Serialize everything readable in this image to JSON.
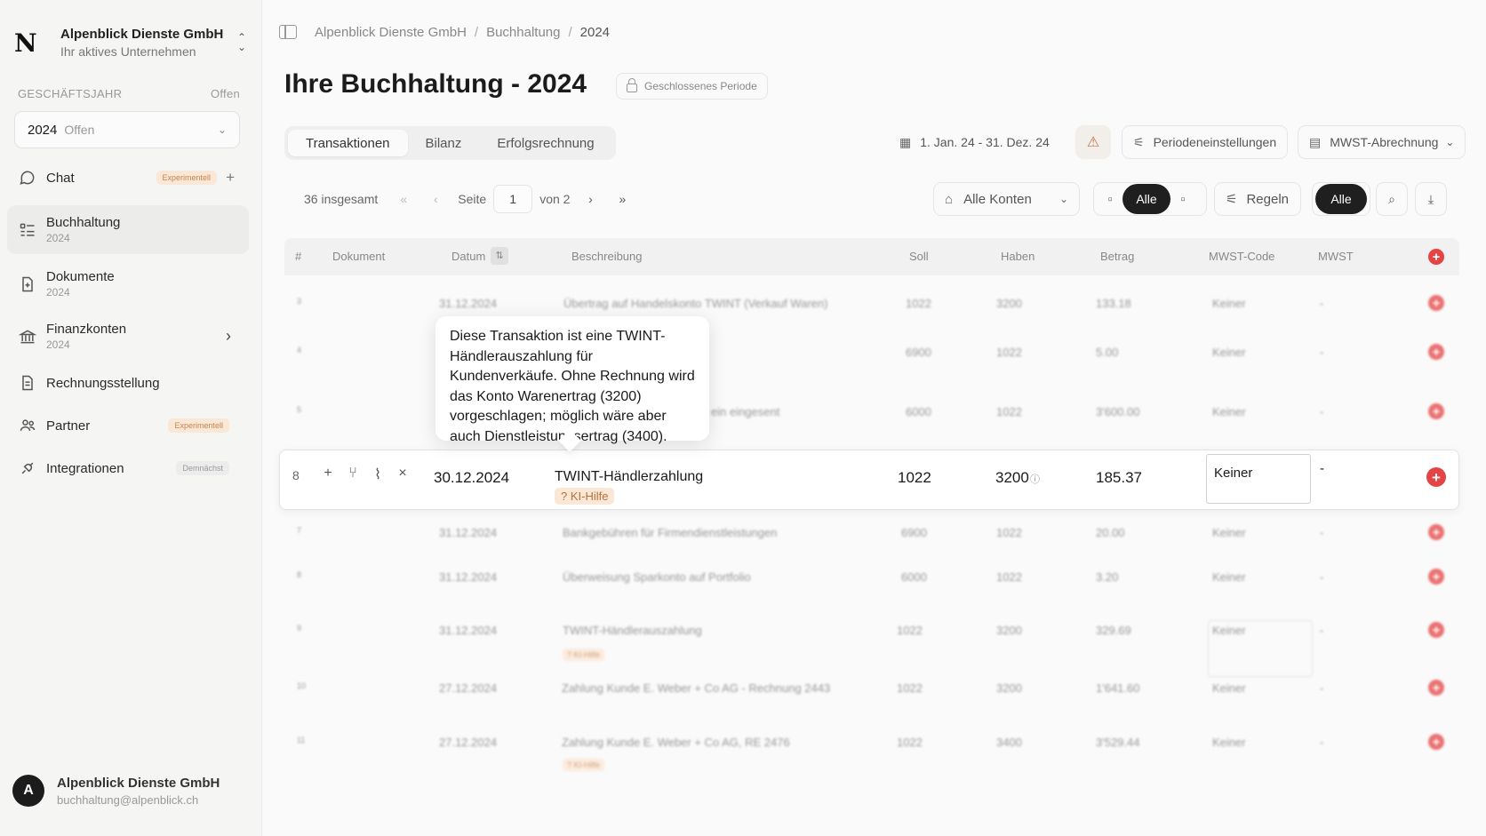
{
  "workspace": {
    "logo": "N",
    "name": "Alpenblick Dienste GmbH",
    "subtitle": "Ihr aktives Unternehmen"
  },
  "fiscal_year": {
    "heading": "GESCHÄFTSJAHR",
    "status": "Offen",
    "selected_year": "2024",
    "selected_status": "Offen"
  },
  "nav": {
    "chat": {
      "label": "Chat",
      "badge": "Experimentell"
    },
    "buchhaltung": {
      "label": "Buchhaltung",
      "sub": "2024"
    },
    "dokumente": {
      "label": "Dokumente",
      "sub": "2024"
    },
    "finanzkonten": {
      "label": "Finanzkonten",
      "sub": "2024"
    },
    "rechnung": {
      "label": "Rechnungsstellung"
    },
    "partner": {
      "label": "Partner",
      "badge": "Experimentell"
    },
    "integrationen": {
      "label": "Integrationen",
      "badge": "Demnächst"
    }
  },
  "user": {
    "initial": "A",
    "name": "Alpenblick Dienste GmbH",
    "email": "buchhaltung@alpenblick.ch"
  },
  "breadcrumb": [
    "Alpenblick Dienste GmbH",
    "Buchhaltung",
    "2024"
  ],
  "page": {
    "title": "Ihre Buchhaltung - 2024",
    "period_badge": "Geschlossenes Periode"
  },
  "tabs": [
    "Transaktionen",
    "Bilanz",
    "Erfolgsrechnung"
  ],
  "toolbar": {
    "date_range": "1. Jan. 24 - 31. Dez. 24",
    "period_settings": "Periodeneinstellungen",
    "vat_report": "MWST-Abrechnung"
  },
  "pagination": {
    "total": "36 insgesamt",
    "page_label": "Seite",
    "current_page": "1",
    "of_label": "von 2"
  },
  "filters": {
    "accounts": "Alle Konten",
    "doc_filter": "Alle",
    "rules": "Regeln",
    "all": "Alle"
  },
  "table": {
    "headers": {
      "num": "#",
      "document": "Dokument",
      "date": "Datum",
      "description": "Beschreibung",
      "debit": "Soll",
      "credit": "Haben",
      "amount": "Betrag",
      "vat_code": "MWST-Code",
      "vat": "MWST"
    },
    "rows": [
      {
        "num": "3",
        "date": "31.12.2024",
        "description": "Übertrag auf Handelskonto TWINT (Verkauf Waren)",
        "debit": "1022",
        "credit": "3200",
        "amount": "133.18",
        "vat_code": "Keiner",
        "vat": "-"
      },
      {
        "num": "4",
        "date": "",
        "description": "",
        "debit": "6900",
        "credit": "1022",
        "amount": "5.00",
        "vat_code": "Keiner",
        "vat": "-"
      },
      {
        "num": "5",
        "date": "",
        "description": "ein eingesent",
        "debit": "6000",
        "credit": "1022",
        "amount": "3'600.00",
        "vat_code": "Keiner",
        "vat": "-"
      },
      {
        "num": "7",
        "date": "31.12.2024",
        "description": "Bankgebühren für Firmendienstleistungen",
        "debit": "6900",
        "credit": "1022",
        "amount": "20.00",
        "vat_code": "Keiner",
        "vat": "-"
      },
      {
        "num": "8",
        "date": "31.12.2024",
        "description": "Überweisung Sparkonto auf Portfolio",
        "debit": "6000",
        "credit": "1022",
        "amount": "3.20",
        "vat_code": "Keiner",
        "vat": "-"
      },
      {
        "num": "9",
        "date": "31.12.2024",
        "description": "TWINT-Händlerauszahlung",
        "debit": "1022",
        "credit": "3200",
        "amount": "329.69",
        "vat_code": "Keiner",
        "vat": "-",
        "hint": "? KI-Hilfe"
      },
      {
        "num": "10",
        "date": "27.12.2024",
        "description": "Zahlung Kunde E. Weber + Co AG - Rechnung 2443",
        "debit": "1022",
        "credit": "3200",
        "amount": "1'641.60",
        "vat_code": "Keiner",
        "vat": "-"
      },
      {
        "num": "11",
        "date": "27.12.2024",
        "description": "Zahlung Kunde E. Weber + Co AG, RE 2476",
        "debit": "1022",
        "credit": "3400",
        "amount": "3'529.44",
        "vat_code": "Keiner",
        "vat": "-",
        "hint": "? KI-Hilfe"
      }
    ],
    "focused_row": {
      "num": "8",
      "date": "30.12.2024",
      "description": "TWINT-Händlerzahlung",
      "hint": "? KI-Hilfe",
      "debit": "1022",
      "credit": "3200",
      "amount": "185.37",
      "vat_code": "Keiner",
      "vat": "-"
    }
  },
  "tooltip": {
    "text": "Diese Transaktion ist eine TWINT-Händlerauszahlung für Kundenverkäufe. Ohne Rechnung wird das Konto Warenertrag (3200) vorgeschlagen; möglich wäre aber auch Dienstleistungsertrag (3400)."
  },
  "colors": {
    "accent_red": "#e54444",
    "hint_bg": "#fbe7d6",
    "dark_pill": "#1f1f1f"
  }
}
